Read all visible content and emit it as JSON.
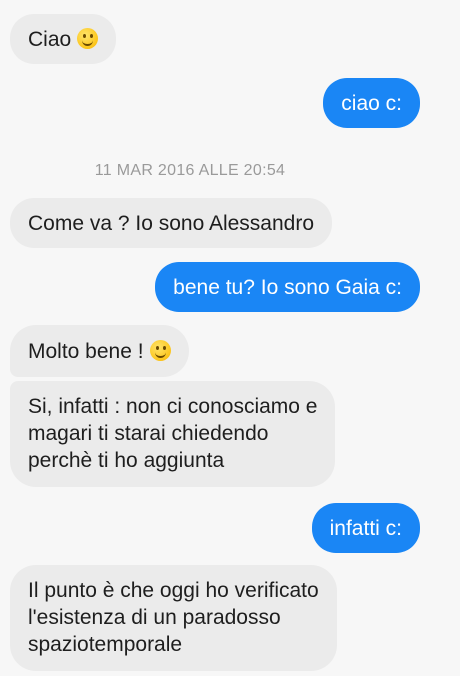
{
  "conversation": {
    "timestamp": "11 MAR 2016 ALLE 20:54",
    "messages": [
      {
        "sender": "other",
        "lines": [
          "Ciao"
        ],
        "emoji": "smiley-emoji"
      },
      {
        "sender": "me",
        "lines": [
          "ciao c:"
        ]
      },
      {
        "sender": "other",
        "lines": [
          "Come va ? Io sono Alessandro"
        ]
      },
      {
        "sender": "me",
        "lines": [
          "bene tu? Io sono Gaia c:"
        ]
      },
      {
        "sender": "other",
        "lines": [
          "Molto bene !"
        ],
        "emoji": "smiley-emoji"
      },
      {
        "sender": "other",
        "lines": [
          "Si, infatti : non ci conosciamo e",
          "magari ti starai chiedendo",
          "perchè ti ho aggiunta"
        ]
      },
      {
        "sender": "me",
        "lines": [
          "infatti c:"
        ]
      },
      {
        "sender": "other",
        "lines": [
          "Il punto è che oggi ho verificato",
          "l'esistenza di un paradosso",
          "spaziotemporale"
        ]
      }
    ]
  },
  "colors": {
    "background": "#f7f7f7",
    "incoming_bubble": "#ebebeb",
    "outgoing_bubble": "#1a86f5",
    "timestamp_text": "#9a9a9a"
  }
}
